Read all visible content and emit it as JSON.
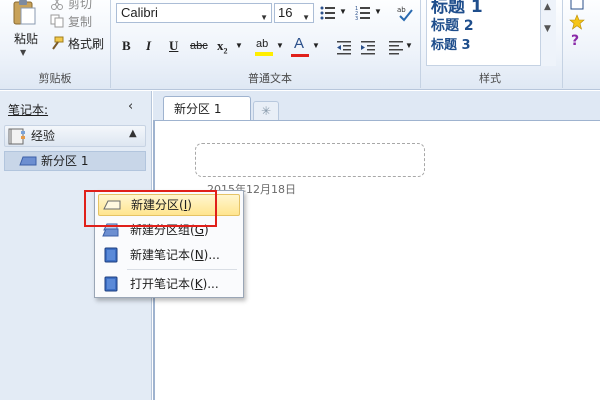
{
  "ribbon": {
    "clipboard": {
      "paste_label": "粘贴",
      "cut_label": "剪切",
      "copy_label": "复制",
      "format_painter_label": "格式刷",
      "group_label": "剪贴板"
    },
    "basic_text": {
      "font_name": "Calibri",
      "font_size": "16",
      "bold": "B",
      "italic": "I",
      "underline": "U",
      "strike": "abc",
      "subscript": "x",
      "font_color_glyph": "A",
      "highlight_glyph": "ab",
      "group_label": "普通文本"
    },
    "styles": {
      "items": [
        "标题 1",
        "标题 2",
        "标题 3"
      ],
      "group_label": "样式"
    },
    "colors": {
      "font_color_bar": "#e0201a",
      "highlight_bar": "#ffee00"
    }
  },
  "nav": {
    "title": "笔记本:",
    "collapse_glyph": "‹",
    "notebook_name": "经验",
    "notebook_chevron": "▲",
    "section_name": "新分区 1"
  },
  "tabs": {
    "active_label": "新分区 1",
    "new_tab_glyph": "✳"
  },
  "page": {
    "date": "2015年12月18日"
  },
  "context_menu": {
    "items": [
      {
        "label": "新建分区(",
        "key": "I",
        "suffix": ")"
      },
      {
        "label": "新建分区组(",
        "key": "G",
        "suffix": ")"
      },
      {
        "label": "新建笔记本(",
        "key": "N",
        "suffix": ")..."
      },
      {
        "label": "打开笔记本(",
        "key": "K",
        "suffix": ")..."
      }
    ]
  },
  "annotation_color": "#e0201a"
}
